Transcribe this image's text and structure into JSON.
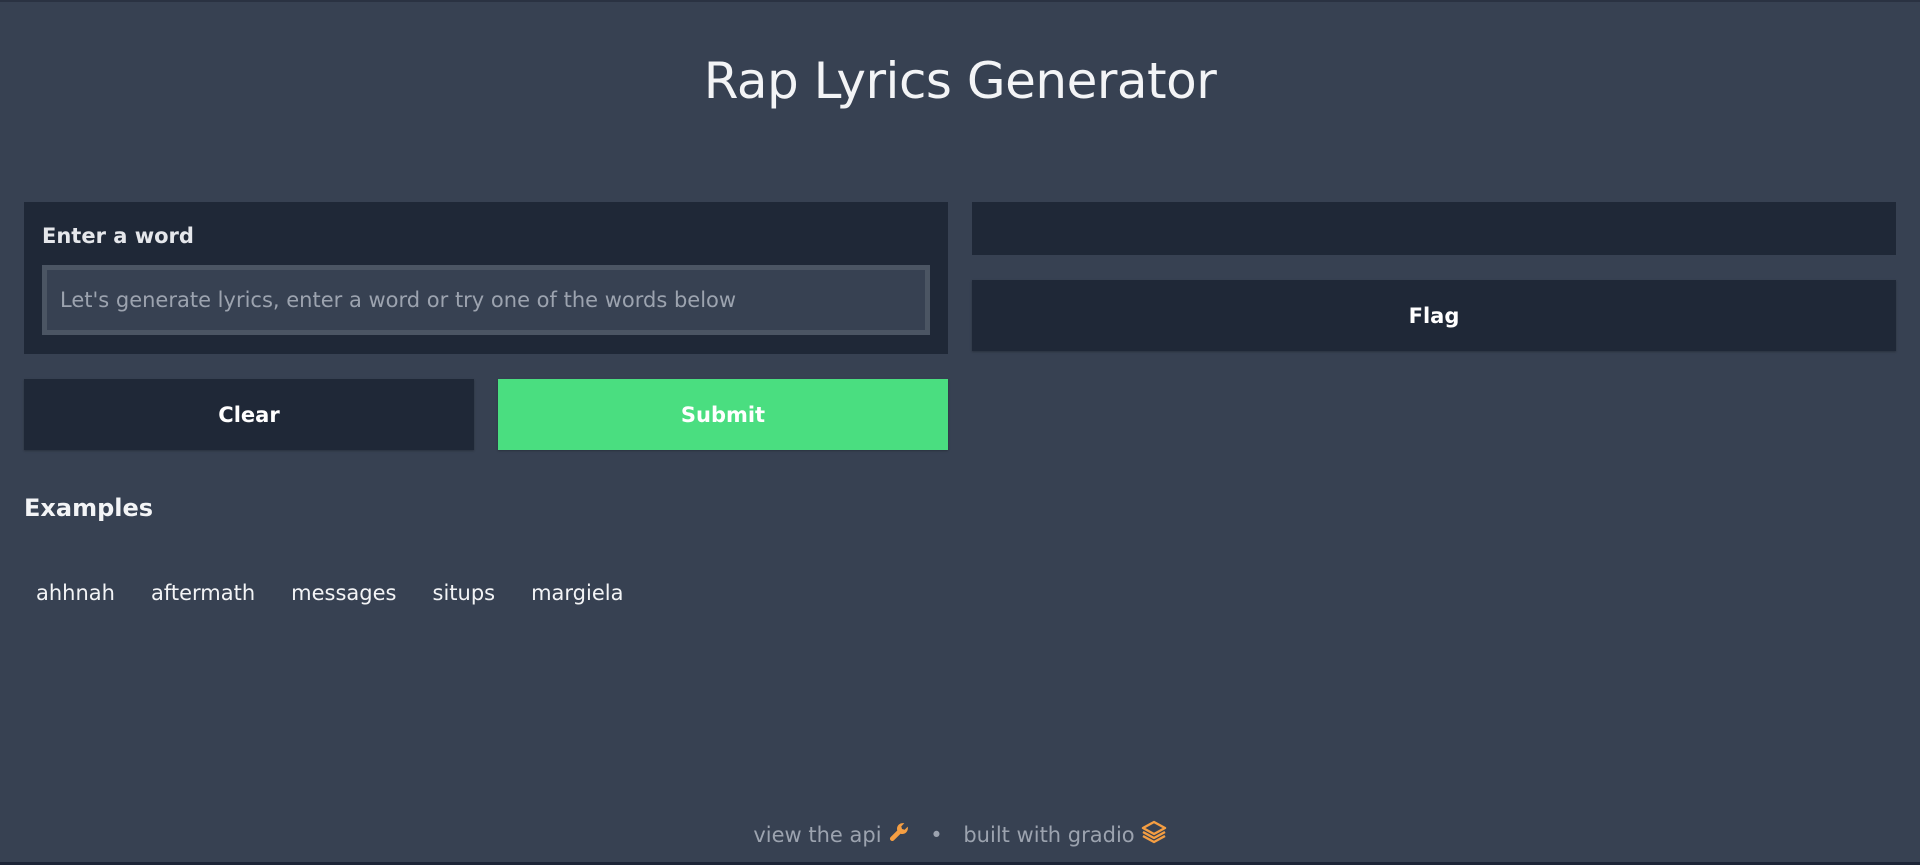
{
  "header": {
    "title": "Rap Lyrics Generator"
  },
  "input": {
    "label": "Enter a word",
    "value": "",
    "placeholder": "Let's generate lyrics, enter a word or try one of the words below"
  },
  "buttons": {
    "clear_label": "Clear",
    "submit_label": "Submit",
    "flag_label": "Flag"
  },
  "output": {
    "value": ""
  },
  "examples": {
    "title": "Examples",
    "items": [
      "ahhnah",
      "aftermath",
      "messages",
      "situps",
      "margiela"
    ]
  },
  "footer": {
    "api_label": "view the api",
    "api_icon": "wrench-icon",
    "separator": "•",
    "built_label": "built with gradio",
    "built_icon": "gradio-logo-icon"
  },
  "colors": {
    "background": "#374152",
    "panel": "#1f2837",
    "submit": "#4ade80",
    "icon_accent": "#f59e42"
  }
}
